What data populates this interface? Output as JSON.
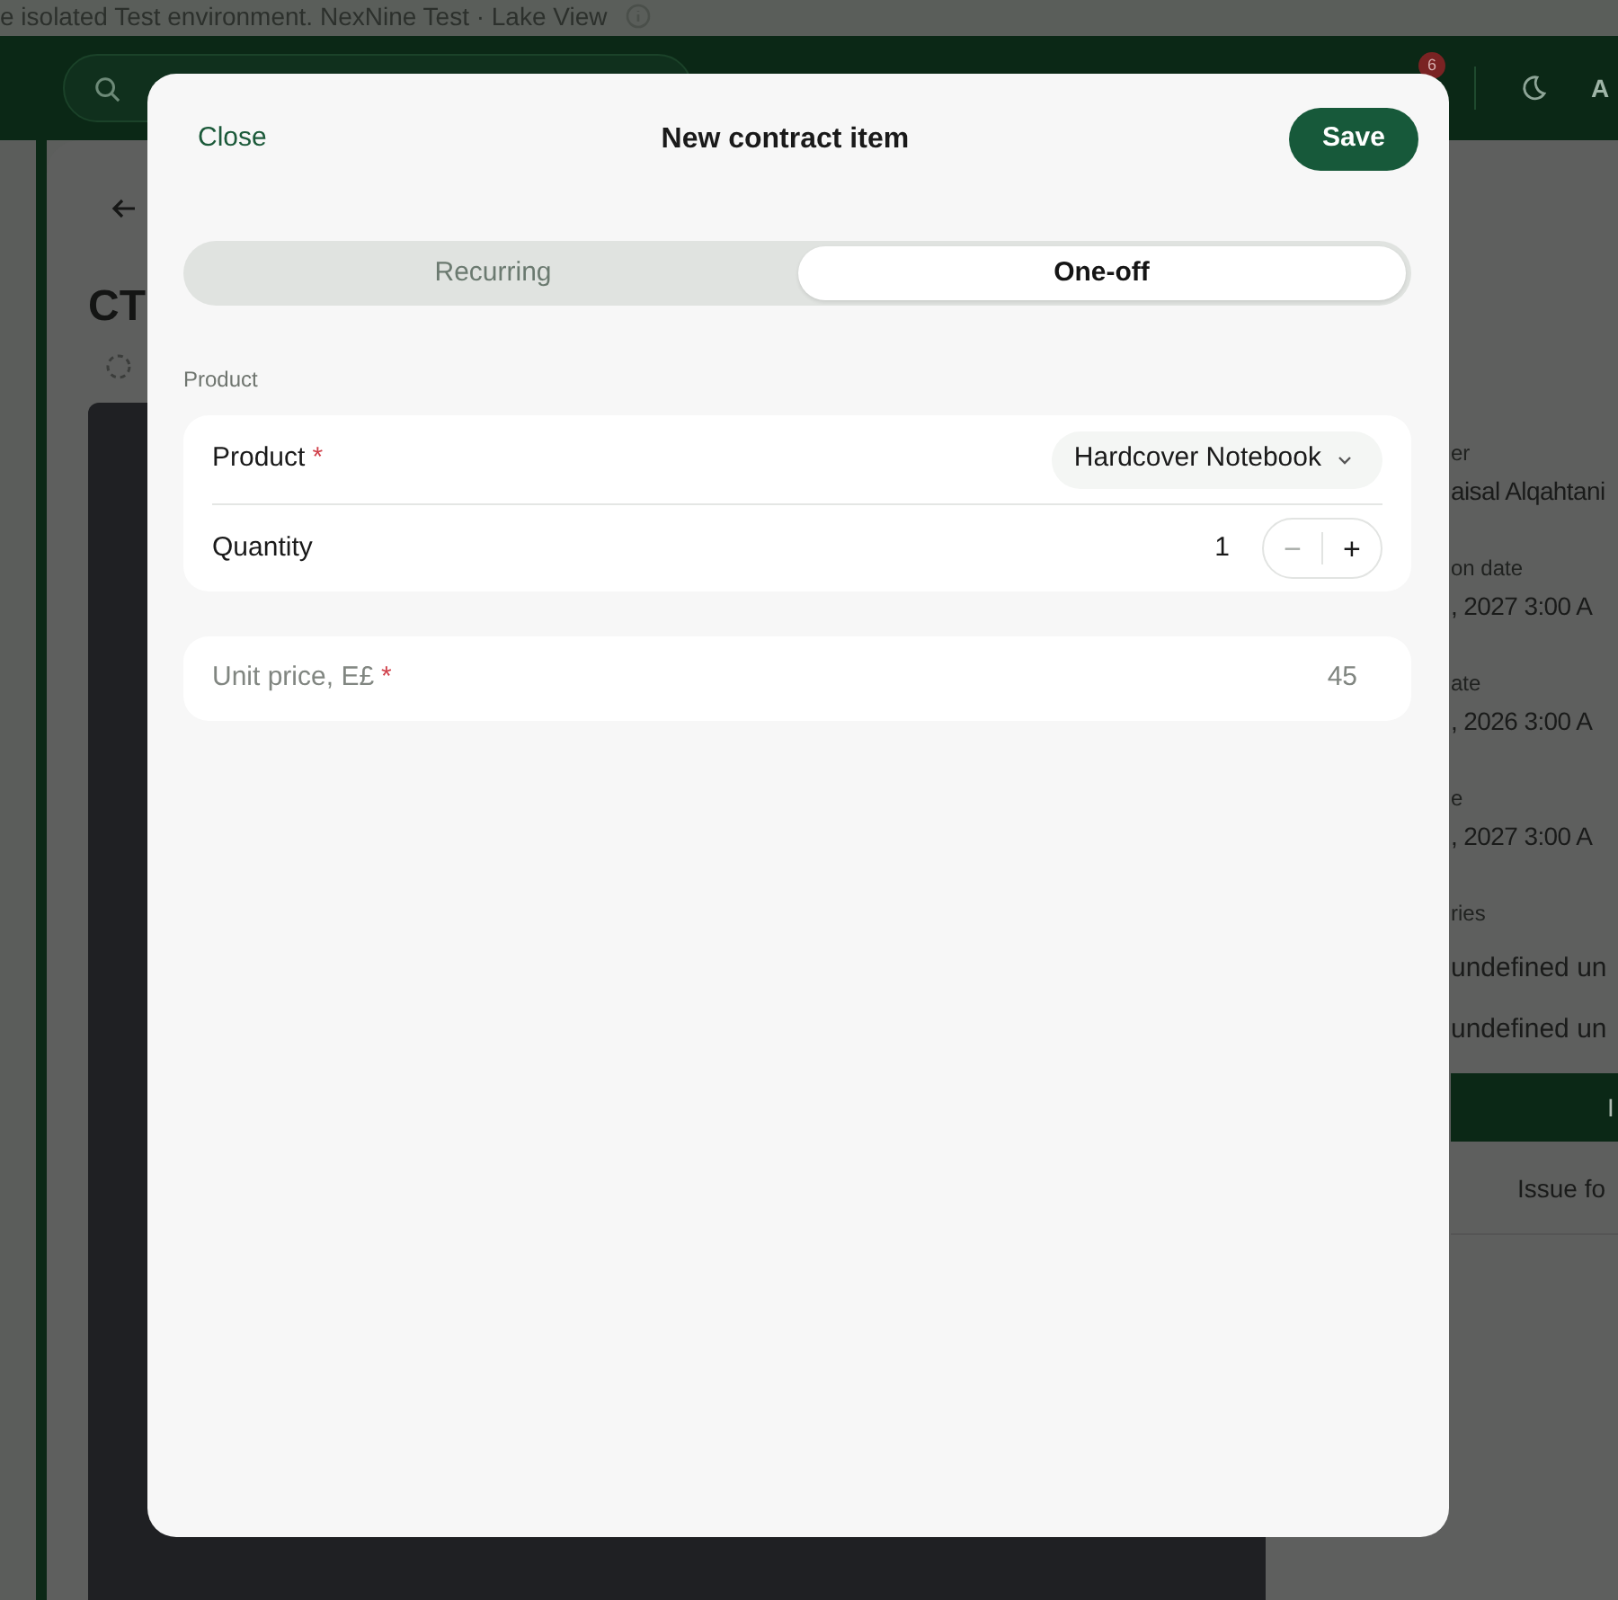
{
  "banner": {
    "text": "e isolated Test environment. NexNine Test · Lake View"
  },
  "header": {
    "notification_count": "6",
    "avatar_initials": "A"
  },
  "page": {
    "title": "CT",
    "details": [
      {
        "label": "er",
        "value": "aisal Alqahtani"
      },
      {
        "label": "on date",
        "value": ", 2027 3:00 A"
      },
      {
        "label": "ate",
        "value": ", 2026 3:00 A"
      },
      {
        "label": "e",
        "value": ", 2027 3:00 A"
      }
    ],
    "entries": {
      "label": "ries",
      "lines": [
        "undefined un",
        "undefined un"
      ]
    },
    "action_bar": {
      "label": "I"
    },
    "table": {
      "columns": [
        "Issue fo"
      ]
    }
  },
  "modal": {
    "close": "Close",
    "title": "New contract item",
    "save": "Save",
    "segments": [
      {
        "label": "Recurring",
        "selected": false
      },
      {
        "label": "One-off",
        "selected": true
      }
    ],
    "section_label": "Product",
    "product": {
      "label": "Product",
      "required_mark": "*",
      "value": "Hardcover Notebook"
    },
    "quantity": {
      "label": "Quantity",
      "value": "1",
      "decrement": "−",
      "increment": "+",
      "decrement_disabled": true
    },
    "unit_price": {
      "label": "Unit price, E£",
      "required_mark": "*",
      "placeholder": "45"
    }
  }
}
